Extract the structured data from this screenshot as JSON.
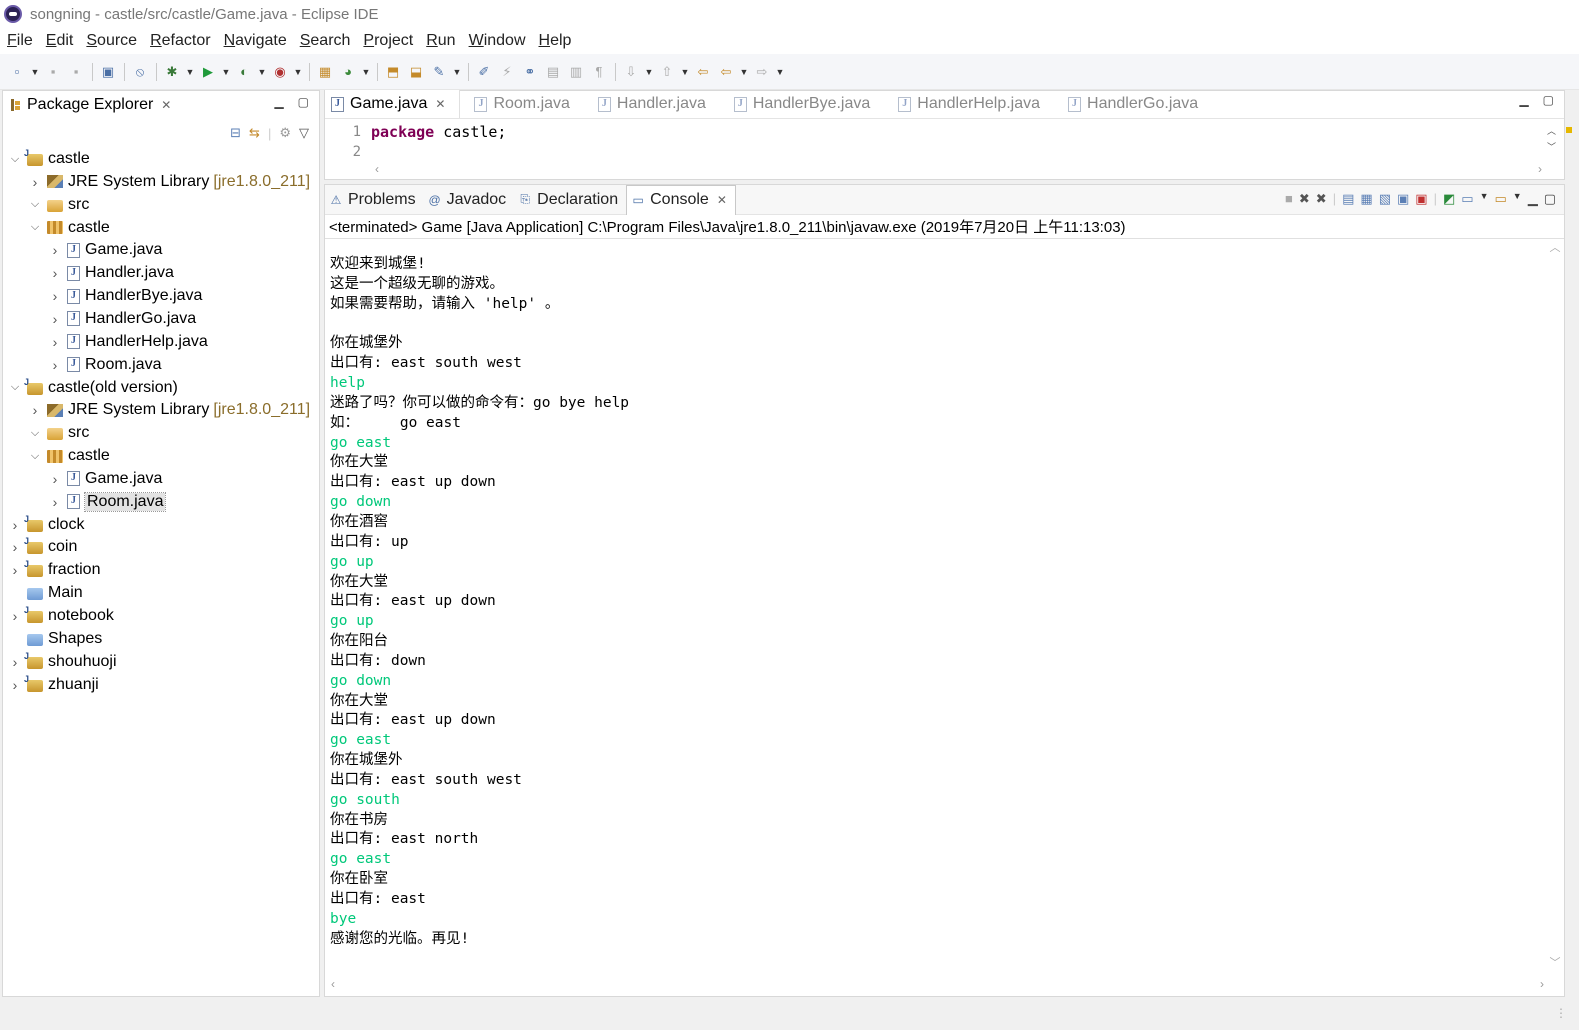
{
  "window": {
    "title": "songning - castle/src/castle/Game.java - Eclipse IDE"
  },
  "menu": [
    "File",
    "Edit",
    "Source",
    "Refactor",
    "Navigate",
    "Search",
    "Project",
    "Run",
    "Window",
    "Help"
  ],
  "package_explorer": {
    "title": "Package Explorer",
    "tree": [
      {
        "label": "castle",
        "type": "project",
        "depth": 0,
        "expanded": true
      },
      {
        "label": "JRE System Library",
        "suffix": "[jre1.8.0_211]",
        "type": "library",
        "depth": 1,
        "expanded": false
      },
      {
        "label": "src",
        "type": "src",
        "depth": 1,
        "expanded": true
      },
      {
        "label": "castle",
        "type": "pkg",
        "depth": 2,
        "expanded": true
      },
      {
        "label": "Game.java",
        "type": "java",
        "depth": 3,
        "expanded": false
      },
      {
        "label": "Handler.java",
        "type": "java",
        "depth": 3,
        "expanded": false
      },
      {
        "label": "HandlerBye.java",
        "type": "java",
        "depth": 3,
        "expanded": false
      },
      {
        "label": "HandlerGo.java",
        "type": "java",
        "depth": 3,
        "expanded": false
      },
      {
        "label": "HandlerHelp.java",
        "type": "java",
        "depth": 3,
        "expanded": false
      },
      {
        "label": "Room.java",
        "type": "java",
        "depth": 3,
        "expanded": false
      },
      {
        "label": "castle(old version)",
        "type": "project",
        "depth": 0,
        "expanded": true
      },
      {
        "label": "JRE System Library",
        "suffix": "[jre1.8.0_211]",
        "type": "library",
        "depth": 1,
        "expanded": false
      },
      {
        "label": "src",
        "type": "src",
        "depth": 1,
        "expanded": true
      },
      {
        "label": "castle",
        "type": "pkg",
        "depth": 2,
        "expanded": true
      },
      {
        "label": "Game.java",
        "type": "java",
        "depth": 3,
        "expanded": false
      },
      {
        "label": "Room.java",
        "type": "java",
        "depth": 3,
        "expanded": false,
        "selected": true
      },
      {
        "label": "clock",
        "type": "project",
        "depth": 0,
        "expanded": false
      },
      {
        "label": "coin",
        "type": "project",
        "depth": 0,
        "expanded": false
      },
      {
        "label": "fraction",
        "type": "project",
        "depth": 0,
        "expanded": false
      },
      {
        "label": "Main",
        "type": "folderblue",
        "depth": 0,
        "noarrow": true
      },
      {
        "label": "notebook",
        "type": "project",
        "depth": 0,
        "expanded": false
      },
      {
        "label": "Shapes",
        "type": "folderblue",
        "depth": 0,
        "noarrow": true
      },
      {
        "label": "shouhuoji",
        "type": "project",
        "depth": 0,
        "expanded": false
      },
      {
        "label": "zhuanji",
        "type": "project",
        "depth": 0,
        "expanded": false
      }
    ]
  },
  "editor": {
    "tabs": [
      "Game.java",
      "Room.java",
      "Handler.java",
      "HandlerBye.java",
      "HandlerHelp.java",
      "HandlerGo.java"
    ],
    "active_tab": "Game.java",
    "line_numbers": [
      "1",
      "2"
    ],
    "code_keyword": "package",
    "code_rest": " castle;"
  },
  "console_view": {
    "tabs": [
      {
        "label": "Problems",
        "icon": "problems-icon"
      },
      {
        "label": "Javadoc",
        "icon": "javadoc-icon"
      },
      {
        "label": "Declaration",
        "icon": "declaration-icon"
      },
      {
        "label": "Console",
        "icon": "console-icon"
      }
    ],
    "active_tab": "Console",
    "status": "<terminated> Game [Java Application] C:\\Program Files\\Java\\jre1.8.0_211\\bin\\javaw.exe (2019年7月20日 上午11:13:03)",
    "lines": [
      {
        "text": "欢迎来到城堡!",
        "input": false
      },
      {
        "text": "这是一个超级无聊的游戏。",
        "input": false
      },
      {
        "text": "如果需要帮助，请输入 'help' 。",
        "input": false
      },
      {
        "text": "",
        "input": false
      },
      {
        "text": "你在城堡外",
        "input": false
      },
      {
        "text": "出口有: east south west",
        "input": false
      },
      {
        "text": "help",
        "input": true
      },
      {
        "text": "迷路了吗？你可以做的命令有：go bye help",
        "input": false
      },
      {
        "text": "如：\tgo east",
        "input": false
      },
      {
        "text": "go east",
        "input": true
      },
      {
        "text": "你在大堂",
        "input": false
      },
      {
        "text": "出口有: east up down",
        "input": false
      },
      {
        "text": "go down",
        "input": true
      },
      {
        "text": "你在酒窖",
        "input": false
      },
      {
        "text": "出口有: up",
        "input": false
      },
      {
        "text": "go up",
        "input": true
      },
      {
        "text": "你在大堂",
        "input": false
      },
      {
        "text": "出口有: east up down",
        "input": false
      },
      {
        "text": "go up",
        "input": true
      },
      {
        "text": "你在阳台",
        "input": false
      },
      {
        "text": "出口有: down",
        "input": false
      },
      {
        "text": "go down",
        "input": true
      },
      {
        "text": "你在大堂",
        "input": false
      },
      {
        "text": "出口有: east up down",
        "input": false
      },
      {
        "text": "go east",
        "input": true
      },
      {
        "text": "你在城堡外",
        "input": false
      },
      {
        "text": "出口有: east south west",
        "input": false
      },
      {
        "text": "go south",
        "input": true
      },
      {
        "text": "你在书房",
        "input": false
      },
      {
        "text": "出口有: east north",
        "input": false
      },
      {
        "text": "go east",
        "input": true
      },
      {
        "text": "你在卧室",
        "input": false
      },
      {
        "text": "出口有: east",
        "input": false
      },
      {
        "text": "bye",
        "input": true
      },
      {
        "text": "感谢您的光临。再见!",
        "input": false
      }
    ]
  },
  "colors": {
    "console_input": "#00c87a",
    "keyword": "#7f0055",
    "library_version": "#8a6d2b"
  }
}
